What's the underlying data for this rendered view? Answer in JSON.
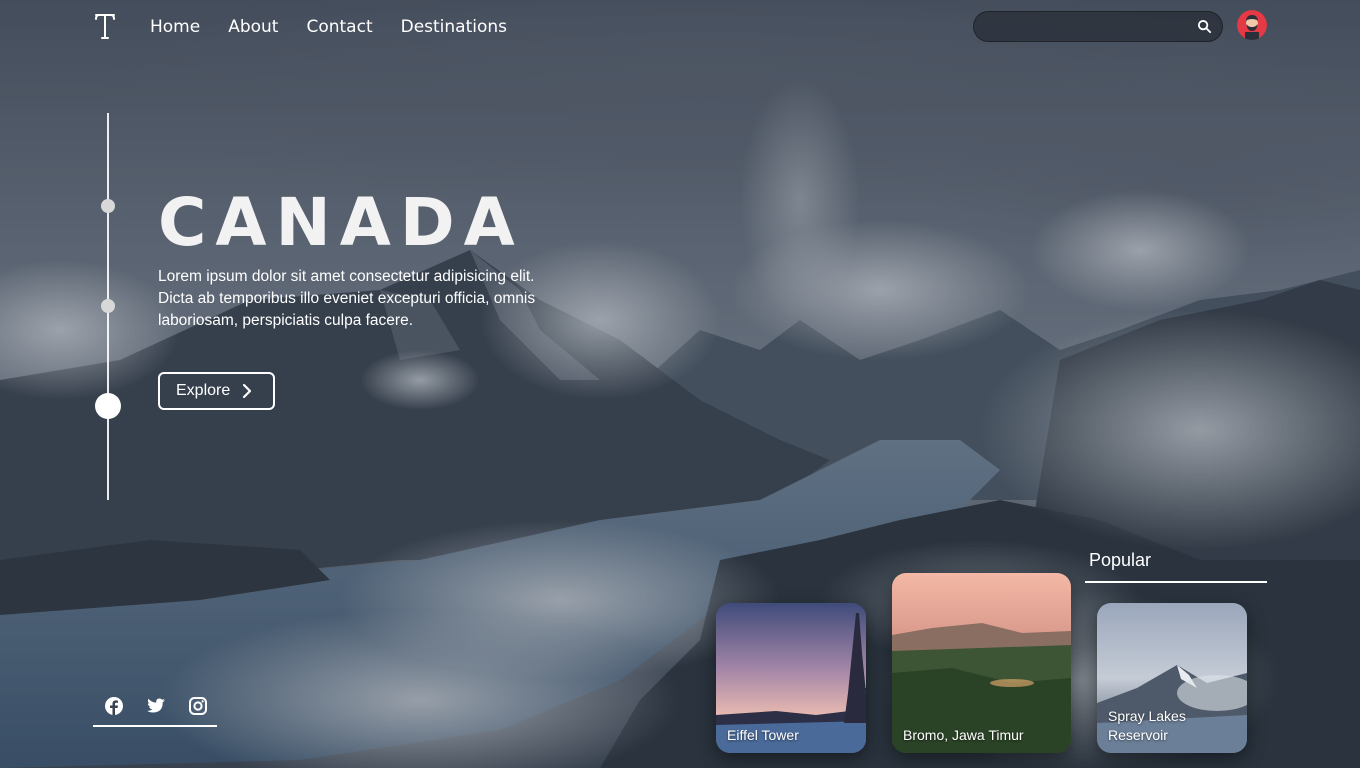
{
  "nav": {
    "logo_letter": "T",
    "links": [
      "Home",
      "About",
      "Contact",
      "Destinations"
    ]
  },
  "search": {
    "value": "",
    "placeholder": "",
    "icon": "search-icon"
  },
  "avatar": {
    "icon": "user-avatar"
  },
  "slider": {
    "dots": 3,
    "active_index": 2
  },
  "hero": {
    "title": "CANADA",
    "description": "Lorem ipsum dolor sit amet consectetur adipisicing elit. Dicta ab temporibus illo eveniet excepturi officia, omnis laboriosam, perspiciatis culpa facere.",
    "explore_label": "Explore",
    "explore_icon": "chevron-right-icon"
  },
  "socials": [
    "facebook-icon",
    "twitter-icon",
    "instagram-icon"
  ],
  "popular": {
    "title": "Popular",
    "cards": [
      {
        "label": "Eiffel Tower"
      },
      {
        "label": "Bromo, Jawa Timur"
      },
      {
        "label": "Spray Lakes Reservoir"
      }
    ]
  },
  "colors": {
    "accent": "#ffffff",
    "overlay": "#3a4350",
    "avatar_bg": "#e53945"
  }
}
